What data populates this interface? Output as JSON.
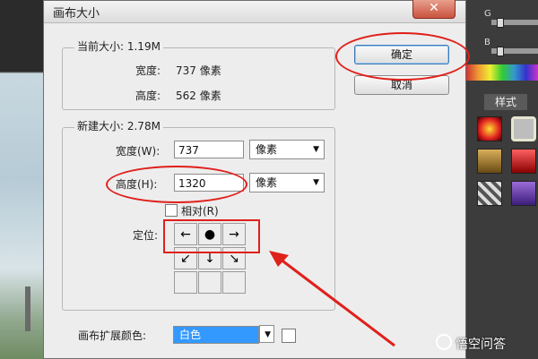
{
  "dialog": {
    "title": "画布大小",
    "close_symbol": "✕"
  },
  "current_size": {
    "label": "当前大小: 1.19M",
    "width_label": "宽度:",
    "width_value": "737 像素",
    "height_label": "高度:",
    "height_value": "562 像素"
  },
  "new_size": {
    "label": "新建大小: 2.78M",
    "width_label": "宽度(W):",
    "width_value": "737",
    "width_unit": "像素",
    "height_label": "高度(H):",
    "height_value": "1320",
    "height_unit": "像素",
    "relative_label": "相对(R)",
    "anchor_label": "定位:"
  },
  "anchor_grid": [
    "←",
    "●",
    "→",
    "↙",
    "↓",
    "↘",
    "",
    "",
    ""
  ],
  "buttons": {
    "ok": "确定",
    "cancel": "取消"
  },
  "extension_color": {
    "label": "画布扩展颜色:",
    "value": "白色"
  },
  "background": {
    "channel_g": "G",
    "channel_b": "B",
    "panel_tab": "样式"
  },
  "watermark": {
    "text": "悟空问答",
    "logo_icon": "wukong-logo-icon"
  },
  "colors": {
    "highlight": "#e0201b",
    "selection": "#3399ff"
  }
}
